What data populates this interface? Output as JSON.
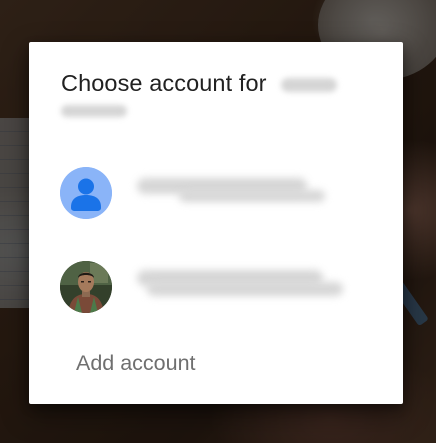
{
  "dialog": {
    "title_prefix": "Choose account for",
    "add_account_label": "Add account"
  },
  "accounts": [
    {
      "avatar_icon": "person-icon",
      "avatar_color": "#8ab4f8",
      "avatar_glyph_color": "#1a73e8"
    },
    {
      "avatar_icon": "profile-photo"
    }
  ],
  "colors": {
    "dialog_background": "#ffffff",
    "title_text": "#212121",
    "secondary_text": "#6f6f6f",
    "scrim": "rgba(0,0,0,0.38)"
  }
}
